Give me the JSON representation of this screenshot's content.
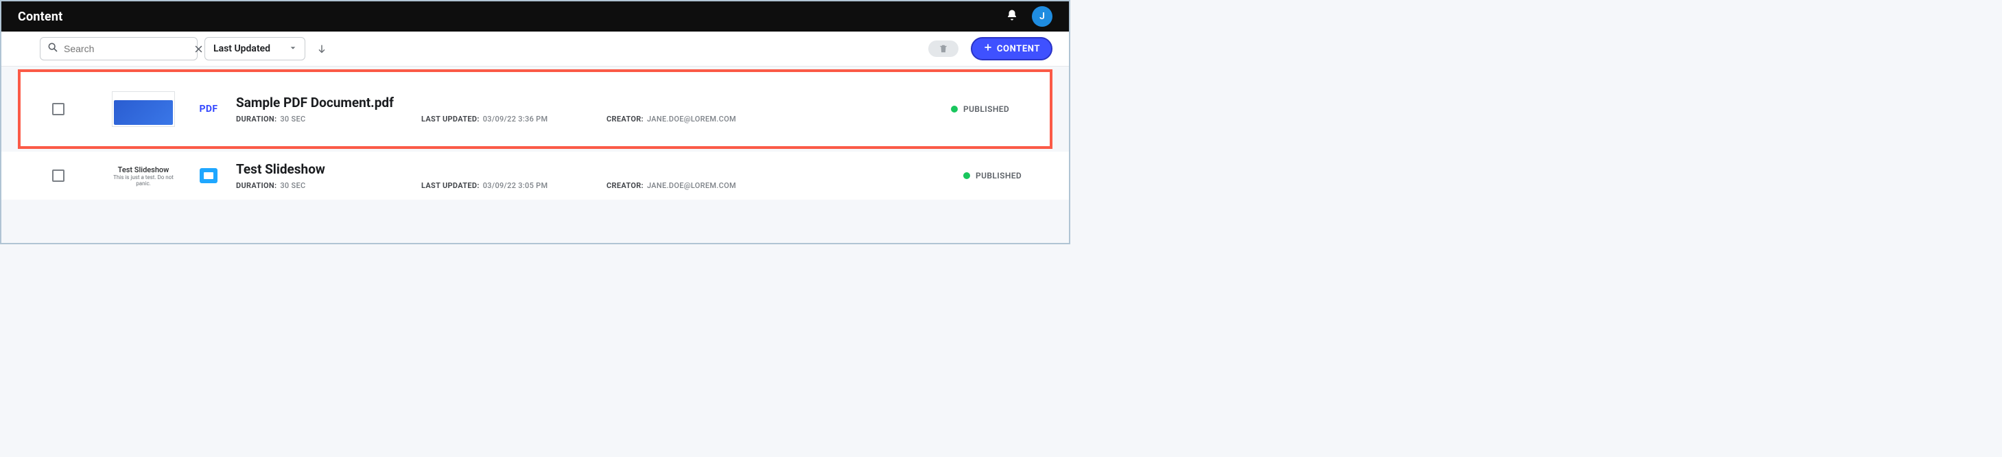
{
  "topbar": {
    "title": "Content",
    "avatar_initial": "J"
  },
  "toolbar": {
    "search_placeholder": "Search",
    "sort_selected": "Last Updated",
    "add_button_label": "CONTENT"
  },
  "labels": {
    "duration": "DURATION:",
    "last_updated": "LAST UPDATED:",
    "creator": "CREATOR:"
  },
  "items": [
    {
      "highlighted": true,
      "type": "pdf",
      "type_label": "PDF",
      "title": "Sample PDF Document.pdf",
      "duration": "30 SEC",
      "last_updated": "03/09/22 3:36 PM",
      "creator": "JANE.DOE@LOREM.COM",
      "status": "PUBLISHED",
      "status_color": "#19c65d"
    },
    {
      "highlighted": false,
      "type": "slideshow",
      "thumb_title": "Test Slideshow",
      "thumb_subtitle": "This is just a test. Do not panic.",
      "title": "Test Slideshow",
      "duration": "30 SEC",
      "last_updated": "03/09/22 3:05 PM",
      "creator": "JANE.DOE@LOREM.COM",
      "status": "PUBLISHED",
      "status_color": "#19c65d"
    }
  ]
}
